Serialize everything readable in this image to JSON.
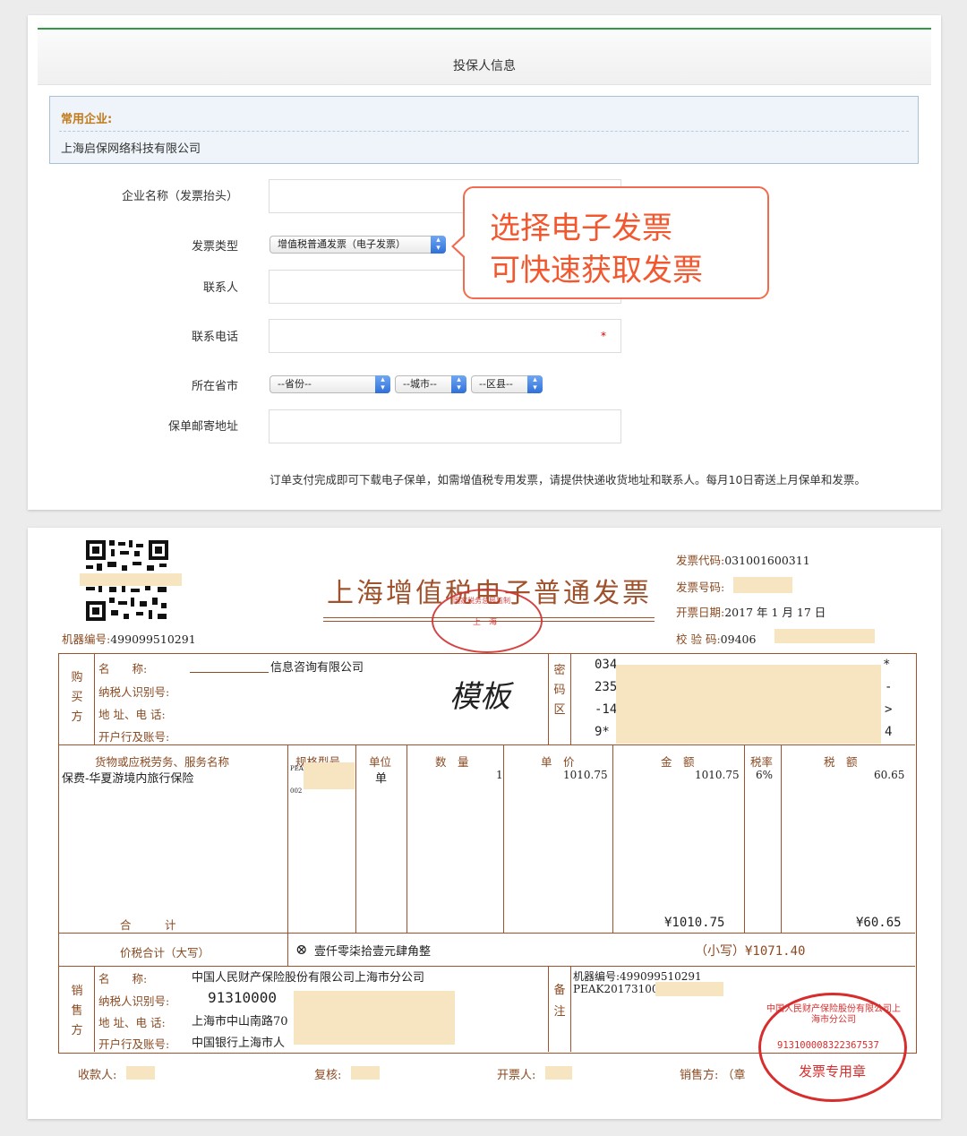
{
  "form": {
    "section_title": "投保人信息",
    "common_company_label": "常用企业:",
    "common_company_name": "上海启保网络科技有限公司",
    "company_name_label": "企业名称（发票抬头）",
    "invoice_type_label": "发票类型",
    "invoice_type_value": "增值税普通发票（电子发票）",
    "contact_label": "联系人",
    "phone_label": "联系电话",
    "region_label": "所在省市",
    "province": "--省份--",
    "city": "--城市--",
    "district": "--区县--",
    "mail_address_label": "保单邮寄地址",
    "required_mark": "*",
    "note": "订单支付完成即可下载电子保单，如需增值税专用发票，请提供快递收货地址和联系人。每月10日寄送上月保单和发票。"
  },
  "callout": {
    "line1": "选择电子发票",
    "line2": "可快速获取发票",
    "color": "#f2572e"
  },
  "invoice": {
    "title": "上海增值税电子普通发票",
    "code_label": "发票代码:",
    "code_value": "031001600311",
    "number_label": "发票号码:",
    "date_label": "开票日期:",
    "date_value": "2017 年  1 月 17 日",
    "check_label": "校 验 码:",
    "check_value": "09406",
    "machine_label": "机器编号:",
    "machine_value": "499099510291",
    "buyer_side": "购买方",
    "cipher_side": "密码区",
    "seller_side": "销售方",
    "remark_side": "备注",
    "buyer": {
      "name_label": "名　　称:",
      "name_value": "信息咨询有限公司",
      "tax_label": "纳税人识别号:",
      "addr_label": "地 址、电 话:",
      "bank_label": "开户行及账号:"
    },
    "watermark": "模板",
    "cipher": {
      "l1a": "034",
      "l1b": "*",
      "l2a": "235",
      "l2b": "-",
      "l3a": "-14",
      "l3b": ">",
      "l4a": "9*",
      "l4b": "4"
    },
    "headers": {
      "goods": "货物或应税劳务、服务名称",
      "spec": "规格型号",
      "unit": "单位",
      "qty": "数　量",
      "price": "单　价",
      "amount": "金　额",
      "rate": "税率",
      "tax": "税　额"
    },
    "item": {
      "name": "保费-华夏游境内旅行保险",
      "spec1": "PEAK",
      "spec2": "002",
      "unit": "单",
      "qty": "1",
      "price": "1010.75",
      "amount": "1010.75",
      "rate": "6%",
      "tax": "60.65"
    },
    "total_label": "合　　　计",
    "total_amount": "¥1010.75",
    "total_tax": "¥60.65",
    "grand_label": "价税合计（大写）",
    "grand_symbol": "⊗",
    "grand_words": "壹仟零柒拾壹元肆角整",
    "grand_small": "（小写）¥1071.40",
    "seller": {
      "name_label": "名　　称:",
      "name_value": "中国人民财产保险股份有限公司上海市分公司",
      "tax_label": "纳税人识别号:",
      "tax_value": "91310000",
      "addr_label": "地 址、电 话:",
      "addr_value": "上海市中山南路70",
      "bank_label": "开户行及账号:",
      "bank_value": "中国银行上海市人"
    },
    "remark": {
      "machine": "机器编号:499099510291",
      "peak": "PEAK20173100"
    },
    "footer": {
      "payee": "收款人:",
      "reviewer": "复核:",
      "issuer": "开票人:",
      "seller": "销售方: （章"
    },
    "stamp_seller": {
      "text": "中国人民财产保险股份有限公司上海市分公司",
      "number": "913100008322367537",
      "label": "发票专用章"
    },
    "stamp_tax": {
      "top": "国家税务总局监制",
      "mid": "上　海"
    }
  }
}
